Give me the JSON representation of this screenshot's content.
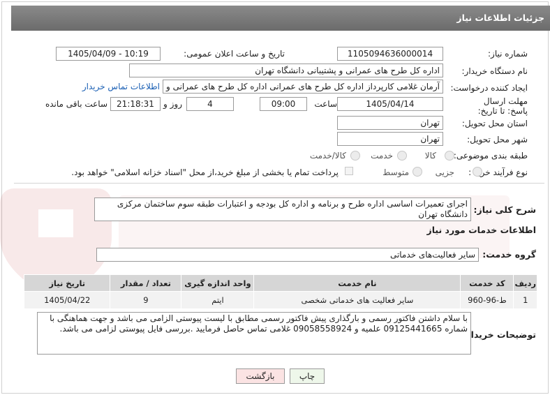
{
  "header": {
    "title": "جزئیات اطلاعات نیاز"
  },
  "fields": {
    "need_number_label": "شماره نیاز:",
    "need_number": "1105094636000014",
    "announce_label": "تاریخ و ساعت اعلان عمومی:",
    "announce_value": "1405/04/09 - 10:19",
    "buyer_org_label": "نام دستگاه خریدار:",
    "buyer_org": "اداره کل طرح های عمرانی و پشتیبانی دانشگاه تهران",
    "requester_label": "ایجاد کننده درخواست:",
    "requester": "آرمان غلامی کارپرداز اداره کل طرح های عمرانی اداره کل طرح های عمرانی و پشتیبانی دانشگاه تهران",
    "buyer_contact_link": "اطلاعات تماس خریدار",
    "deadline_label": "مهلت ارسال پاسخ: تا تاریخ:",
    "deadline_date": "1405/04/14",
    "time_label": "ساعت",
    "deadline_time": "09:00",
    "days_value": "4",
    "days_label": "روز و",
    "remaining_time": "21:18:31",
    "remaining_label": "ساعت باقی مانده",
    "province_label": "استان محل تحویل:",
    "province": "تهران",
    "city_label": "شهر محل تحویل:",
    "city": "تهران",
    "category_label": "طبقه بندی موضوعی:",
    "category_options": [
      "کالا",
      "خدمت",
      "کالا/خدمت"
    ],
    "process_label": "نوع فرآیند خرید :",
    "process_options": [
      "جزیی",
      "متوسط"
    ],
    "treasury_note": "پرداخت تمام یا بخشی از مبلغ خرید،از محل \"اسناد خزانه اسلامی\" خواهد بود."
  },
  "description": {
    "label": "شرح کلی نیاز:",
    "text": "اجرای تعمیرات اساسی اداره طرح و برنامه و اداره کل بودجه و اعتبارات طبقه سوم ساختمان مرکزی دانشگاه تهران"
  },
  "services": {
    "section_title": "اطلاعات خدمات مورد نیاز",
    "group_label": "گروه خدمت:",
    "group_value": "سایر فعالیت‌های خدماتی",
    "columns": [
      "ردیف",
      "کد خدمت",
      "نام خدمت",
      "واحد اندازه گیری",
      "تعداد / مقدار",
      "تاریخ نیاز"
    ],
    "rows": [
      [
        "1",
        "ط-96-960",
        "سایر فعالیت های خدماتی شخصی",
        "ایتم",
        "9",
        "1405/04/22"
      ]
    ]
  },
  "buyer_notes": {
    "label": "توضیحات خریدار:",
    "text": "با سلام داشتن فاکتور رسمی و بارگذاری پیش فاکتور رسمی مطابق با لیست پیوستی الزامی می باشد و جهت هماهنگی با شماره 09125441665 علمیه و 09058558924 غلامی تماس حاصل فرمایید .بررسی فایل پیوستی لزامی می باشد."
  },
  "buttons": {
    "print": "چاپ",
    "back": "بازگشت"
  },
  "colors": {
    "header_bg": "#777777",
    "back_button": "#fbe3e3",
    "print_button": "#eef7ea",
    "link": "#1a5fb4"
  }
}
